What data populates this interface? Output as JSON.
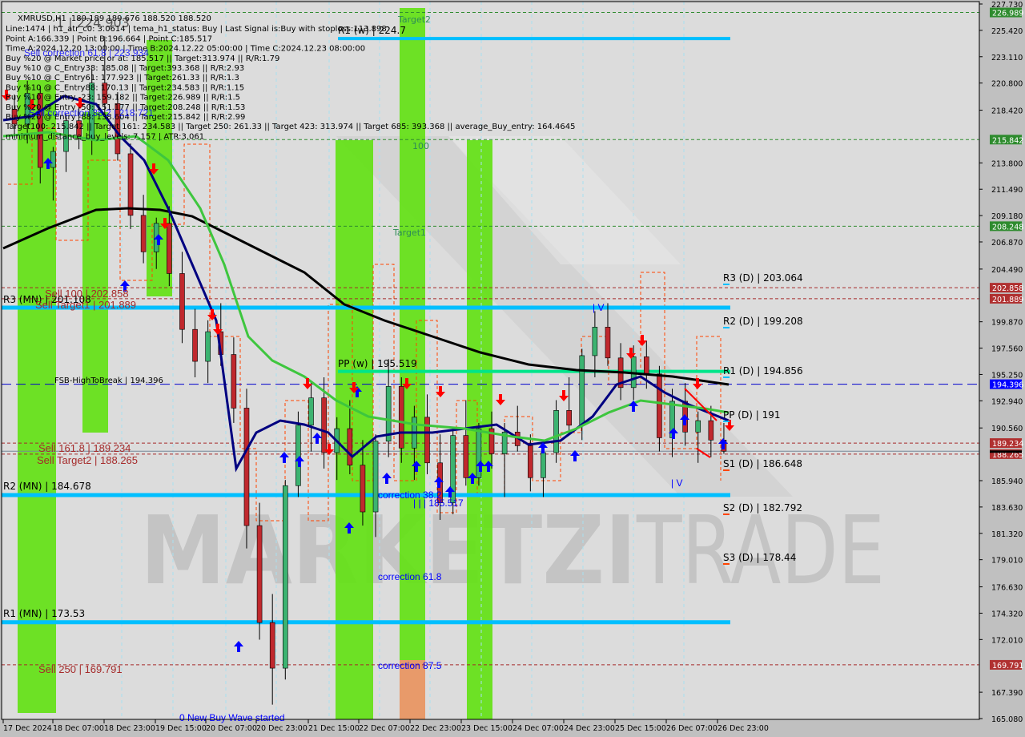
{
  "header": {
    "symbol": "XMRUSD,H1",
    "ohlc": "189.189 189.676 188.520 188.520"
  },
  "info_lines": [
    "Line:1474 | h1_atr_c0: 3.0614 | tema_h1_status: Buy | Last Signal is:Buy with stoploss:113.898",
    "Point A:166.339 | Point B:196.664 | Point C:185.517",
    "Time A:2024.12.20 13:00:00 | Time B:2024.12.22 05:00:00 | Time C:2024.12.23 08:00:00",
    "Buy %20 @ Market price or at: 185.517 || Target:313.974 || R/R:1.79",
    "Buy %10 @ C_Entry38: 185.08 || Target:393.368 || R/R:2.93",
    "Buy %10 @ C_Entry61: 177.923 || Target:261.33 || R/R:1.3",
    "Buy %10 @ C_Entry88: 170.13 || Target:234.583 || R/R:1.15",
    "Buy %10 @ Entry -23: 159.182 || Target:226.989 || R/R:1.5",
    "Buy %20 @ Entry -50: 151.177 || Target:208.248 || R/R:1.53",
    "Buy %20 @ Entry -88: 138.604 || Target:215.842 || R/R:2.99",
    "Target100: 215.842 || Target 161: 234.583 || Target 250: 261.33 || Target 423: 313.974 || Target 685: 393.368 || average_Buy_entry: 164.4645",
    "minimum_distance_buy_levels: 7.157 | ATR:3.061"
  ],
  "overlay_texts": {
    "sell_correction_61": "Sell correction 61.8 | 223.934",
    "sell_correction_38": "Sell correction 38.2 | 218.721",
    "wave_label_top": "1 | 224.903",
    "new_buy_wave": "0 New Buy Wave started",
    "fsb": "FSB-HighToBreak | 194.396",
    "point_c": "| | | 185.517",
    "wave_marks": [
      "| V",
      "| V"
    ]
  },
  "zone_labels": {
    "target2": "Target2",
    "target1": "Target1",
    "hundred": "100"
  },
  "pivots": {
    "monthly": [
      {
        "label": "R3 (MN) | 201.108",
        "value": 201.108
      },
      {
        "label": "R2 (MN) | 184.678",
        "value": 184.678
      },
      {
        "label": "R1 (MN) | 173.53",
        "value": 173.53
      }
    ],
    "weekly": [
      {
        "label": "R1 (w) | 224.7",
        "value": 224.7
      },
      {
        "label": "PP (w) | 195.519",
        "value": 195.519
      }
    ],
    "daily": [
      {
        "label": "R3 (D) | 203.064",
        "value": 203.064
      },
      {
        "label": "R2 (D) | 199.208",
        "value": 199.208
      },
      {
        "label": "R1 (D) | 194.856",
        "value": 194.856
      },
      {
        "label": "PP (D) | 191",
        "value": 191
      },
      {
        "label": "S1 (D) | 186.648",
        "value": 186.648
      },
      {
        "label": "S2 (D) | 182.792",
        "value": 182.792
      },
      {
        "label": "S3 (D) | 178.44",
        "value": 178.44
      }
    ]
  },
  "sell_levels": [
    {
      "label": "Sell 100 | 202.858",
      "value": 202.858
    },
    {
      "label": "Sell Target1 | 201.889",
      "value": 201.889
    },
    {
      "label": "Sell 161.8 | 189.234",
      "value": 189.234
    },
    {
      "label": "Sell Target2 | 188.265",
      "value": 188.265
    },
    {
      "label": "Sell  250 | 169.791",
      "value": 169.791
    }
  ],
  "corrections": [
    {
      "label": "correction 38.2",
      "value": 184.68
    },
    {
      "label": "correction 61.8",
      "value": 178.0
    },
    {
      "label": "correction 87.5",
      "value": 169.8
    }
  ],
  "price_tags": [
    {
      "value": "226.989",
      "color": "#2e8b2e"
    },
    {
      "value": "215.842",
      "color": "#2e8b2e"
    },
    {
      "value": "208.248",
      "color": "#2e8b2e"
    },
    {
      "value": "202.858",
      "color": "#b03030"
    },
    {
      "value": "201.889",
      "color": "#b03030"
    },
    {
      "value": "194.396",
      "color": "#0000ff"
    },
    {
      "value": "189.234",
      "color": "#b03030"
    },
    {
      "value": "188.265",
      "color": "#b03030"
    },
    {
      "value": "169.791",
      "color": "#b03030"
    }
  ],
  "watermark": {
    "bold": "MARKETZI",
    "light": "TRADE"
  },
  "colors": {
    "background": "#dcdcdc",
    "bull_candle": "#3cb371",
    "bear_candle": "#c0282d",
    "pivot_line": "#00bfff",
    "weekly_pp": "#00e58a",
    "zone_green": "#66e01a",
    "zone_orange": "#e89a6a",
    "ma_black": "#000000",
    "ma_navy": "#000080",
    "ma_green": "#3ec63e",
    "fsb_line": "#0000cd",
    "channel": "#ff4500"
  },
  "chart_data": {
    "type": "candlestick",
    "title": "XMRUSD,H1",
    "ylim": [
      165.08,
      227.73
    ],
    "y_ticks": [
      227.73,
      225.42,
      223.11,
      220.8,
      218.42,
      213.8,
      211.49,
      209.18,
      206.87,
      204.49,
      199.87,
      197.56,
      195.25,
      192.94,
      190.56,
      185.94,
      183.63,
      181.32,
      179.01,
      176.63,
      174.32,
      172.01,
      167.39,
      165.08
    ],
    "x_ticks": [
      "17 Dec 2024",
      "18 Dec 07:00",
      "18 Dec 23:00",
      "19 Dec 15:00",
      "20 Dec 07:00",
      "20 Dec 23:00",
      "21 Dec 15:00",
      "22 Dec 07:00",
      "22 Dec 23:00",
      "23 Dec 15:00",
      "24 Dec 07:00",
      "24 Dec 23:00",
      "25 Dec 15:00",
      "26 Dec 07:00",
      "26 Dec 23:00"
    ],
    "last_close": 188.52,
    "candles_approx": [
      [
        218.5,
        219.8,
        216.0,
        217.2
      ],
      [
        217.2,
        221.0,
        215.5,
        219.9
      ],
      [
        219.9,
        220.5,
        212.0,
        213.4
      ],
      [
        213.4,
        215.2,
        210.5,
        214.8
      ],
      [
        214.8,
        218.0,
        213.0,
        217.5
      ],
      [
        217.5,
        219.3,
        215.0,
        215.9
      ],
      [
        215.9,
        222.0,
        214.5,
        220.8
      ],
      [
        220.8,
        224.9,
        218.0,
        219.0
      ],
      [
        219.0,
        220.0,
        214.0,
        214.6
      ],
      [
        214.6,
        215.5,
        208.0,
        209.2
      ],
      [
        209.2,
        211.0,
        205.0,
        206.0
      ],
      [
        206.0,
        209.0,
        204.5,
        208.5
      ],
      [
        208.5,
        210.0,
        203.0,
        204.1
      ],
      [
        204.1,
        206.0,
        198.0,
        199.2
      ],
      [
        199.2,
        201.0,
        195.0,
        196.4
      ],
      [
        196.4,
        200.0,
        194.5,
        199.0
      ],
      [
        199.0,
        201.5,
        196.0,
        197.0
      ],
      [
        197.0,
        198.5,
        191.0,
        192.3
      ],
      [
        192.3,
        194.0,
        180.0,
        182.0
      ],
      [
        182.0,
        184.0,
        172.0,
        173.5
      ],
      [
        173.5,
        176.0,
        166.3,
        169.5
      ],
      [
        169.5,
        186.0,
        168.5,
        185.5
      ],
      [
        185.5,
        192.0,
        184.5,
        190.8
      ],
      [
        190.8,
        194.5,
        188.5,
        193.2
      ],
      [
        193.2,
        195.0,
        187.0,
        188.4
      ],
      [
        188.4,
        191.5,
        186.0,
        190.5
      ],
      [
        190.5,
        193.0,
        186.5,
        187.3
      ],
      [
        187.3,
        189.5,
        182.0,
        183.2
      ],
      [
        183.2,
        190.0,
        181.0,
        189.4
      ],
      [
        189.4,
        196.6,
        188.0,
        194.2
      ],
      [
        194.2,
        195.0,
        187.5,
        188.8
      ],
      [
        188.8,
        192.5,
        186.0,
        191.5
      ],
      [
        191.5,
        193.5,
        186.5,
        187.5
      ],
      [
        187.5,
        190.0,
        182.5,
        184.0
      ],
      [
        184.0,
        190.5,
        183.0,
        189.9
      ],
      [
        189.9,
        193.0,
        185.5,
        186.2
      ],
      [
        186.2,
        191.0,
        185.5,
        190.5
      ],
      [
        190.5,
        192.0,
        187.0,
        188.3
      ],
      [
        188.3,
        191.0,
        184.5,
        190.2
      ],
      [
        190.2,
        192.5,
        188.5,
        189.0
      ],
      [
        189.0,
        190.0,
        185.0,
        186.2
      ],
      [
        186.2,
        189.0,
        184.5,
        188.4
      ],
      [
        188.4,
        193.0,
        187.5,
        192.1
      ],
      [
        192.1,
        195.0,
        190.0,
        190.8
      ],
      [
        190.8,
        197.5,
        189.5,
        196.9
      ],
      [
        196.9,
        200.8,
        195.0,
        199.4
      ],
      [
        199.4,
        201.5,
        196.0,
        196.7
      ],
      [
        196.7,
        198.0,
        193.0,
        194.1
      ],
      [
        194.1,
        197.8,
        193.0,
        196.8
      ],
      [
        196.8,
        198.2,
        194.0,
        195.3
      ],
      [
        195.3,
        196.0,
        188.5,
        189.7
      ],
      [
        189.7,
        194.0,
        188.0,
        192.9
      ],
      [
        192.9,
        194.5,
        189.0,
        190.2
      ],
      [
        190.2,
        192.0,
        187.5,
        191.2
      ],
      [
        191.2,
        192.5,
        188.0,
        189.5
      ],
      [
        189.5,
        191.0,
        188.3,
        188.52
      ]
    ]
  }
}
